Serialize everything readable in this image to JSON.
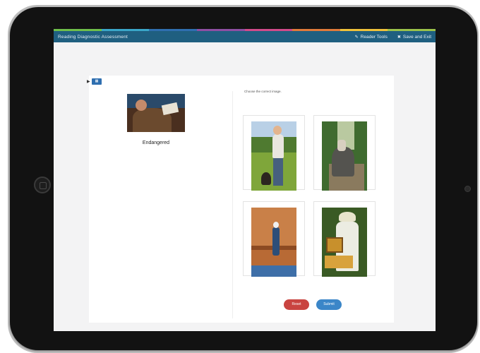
{
  "app": {
    "title": "Reading Diagnostic Assessment",
    "toolbar": {
      "reader_tools_label": "Reader Tools",
      "save_exit_label": "Save and Exit"
    },
    "stripe_colors": [
      "#6fbf4a",
      "#3aa7c9",
      "#2f6fb0",
      "#8e4fa3",
      "#d24b8a",
      "#e07a3a",
      "#f0c23a",
      "#9bc24a"
    ]
  },
  "passage": {
    "title": "Endangered",
    "paragraphs": [
      "",
      ""
    ]
  },
  "question": {
    "label": "Choose the correct image.",
    "text": "",
    "choices": [
      {
        "id": "a",
        "subject": "woman-with-dog-photo"
      },
      {
        "id": "b",
        "subject": "elephant-photo"
      },
      {
        "id": "c",
        "subject": "dig-site-photo"
      },
      {
        "id": "d",
        "subject": "beekeeper-photo"
      }
    ]
  },
  "buttons": {
    "reset_label": "Reset",
    "submit_label": "Submit"
  },
  "colors": {
    "topbar": "#1f5f80",
    "reset": "#c94440",
    "submit": "#3b86c8"
  }
}
